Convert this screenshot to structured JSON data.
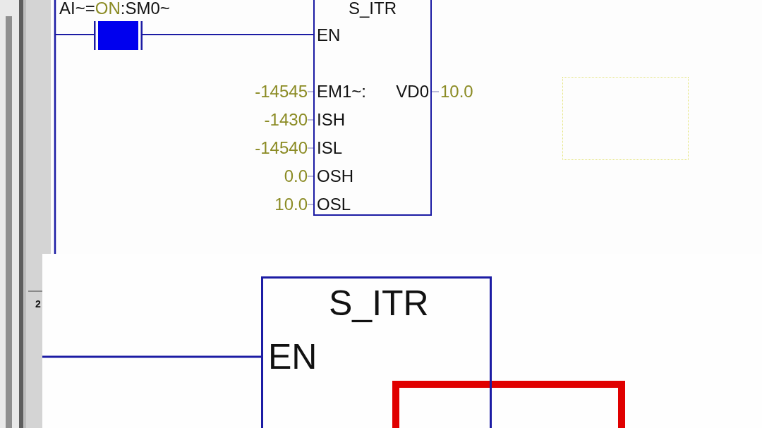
{
  "network_1": {
    "contact": {
      "label": [
        {
          "kind": "text",
          "text": "AI~="
        },
        {
          "kind": "value",
          "text": "ON"
        },
        {
          "kind": "text",
          "text": ":SM0~"
        }
      ],
      "energized": true
    },
    "block": {
      "title": "S_ITR",
      "enable_pin": "EN",
      "inputs": [
        {
          "value": "-14545",
          "pin": "EM1~:"
        },
        {
          "value": "-1430",
          "pin": "ISH"
        },
        {
          "value": "-14540",
          "pin": "ISL"
        },
        {
          "value": "0.0",
          "pin": "OSH"
        },
        {
          "value": "10.0",
          "pin": "OSL"
        }
      ],
      "outputs": [
        {
          "pin": "VD0",
          "value": "10.0"
        }
      ]
    }
  },
  "network_2": {
    "number": "2"
  },
  "zoom_inset": {
    "block": {
      "title": "S_ITR",
      "enable_pin": "EN"
    }
  }
}
